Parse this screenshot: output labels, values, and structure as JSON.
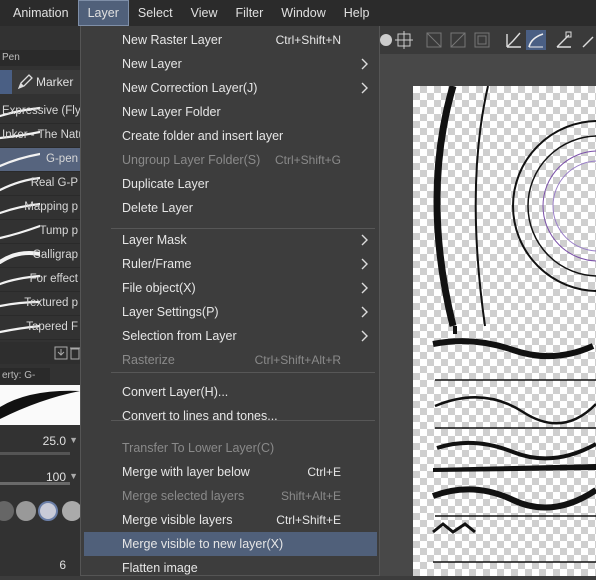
{
  "menubar": {
    "items": [
      "Animation",
      "Layer",
      "Select",
      "View",
      "Filter",
      "Window",
      "Help"
    ],
    "active": "Layer"
  },
  "left_panel": {
    "tab_label": "Pen",
    "marker_label": "Marker",
    "brushes": [
      {
        "label": "Expressive (Flyla"
      },
      {
        "label": "Inker - The Natu"
      },
      {
        "label": "G-pen"
      },
      {
        "label": "Real G-P"
      },
      {
        "label": "Mapping p"
      },
      {
        "label": "Tump p"
      },
      {
        "label": "Calligrap"
      },
      {
        "label": "For effect"
      },
      {
        "label": "Textured p"
      },
      {
        "label": "Tapered F"
      }
    ],
    "property_header": "erty: G-pen",
    "size_value": "25.0",
    "opacity_value": "100",
    "bottom_value": "6"
  },
  "layer_menu": {
    "items": [
      {
        "label": "New Raster Layer",
        "shortcut": "Ctrl+Shift+N",
        "submenu": false,
        "disabled": false
      },
      {
        "label": "New Layer",
        "shortcut": "",
        "submenu": true,
        "disabled": false
      },
      {
        "label": "New Correction Layer(J)",
        "shortcut": "",
        "submenu": true,
        "disabled": false
      },
      {
        "label": "New Layer Folder",
        "shortcut": "",
        "submenu": false,
        "disabled": false
      },
      {
        "label": "Create folder and insert layer",
        "shortcut": "",
        "submenu": false,
        "disabled": false
      },
      {
        "label": "Ungroup Layer Folder(S)",
        "shortcut": "Ctrl+Shift+G",
        "submenu": false,
        "disabled": true
      },
      {
        "label": "Duplicate Layer",
        "shortcut": "",
        "submenu": false,
        "disabled": false
      },
      {
        "label": "Delete Layer",
        "shortcut": "",
        "submenu": false,
        "disabled": false
      },
      {
        "label": "Layer Mask",
        "shortcut": "",
        "submenu": true,
        "disabled": false
      },
      {
        "label": "Ruler/Frame",
        "shortcut": "",
        "submenu": true,
        "disabled": false
      },
      {
        "label": "File object(X)",
        "shortcut": "",
        "submenu": true,
        "disabled": false
      },
      {
        "label": "Layer Settings(P)",
        "shortcut": "",
        "submenu": true,
        "disabled": false
      },
      {
        "label": "Selection from Layer",
        "shortcut": "",
        "submenu": true,
        "disabled": false
      },
      {
        "label": "Rasterize",
        "shortcut": "Ctrl+Shift+Alt+R",
        "submenu": false,
        "disabled": true
      },
      {
        "label": "Convert Layer(H)...",
        "shortcut": "",
        "submenu": false,
        "disabled": false
      },
      {
        "label": "Convert to lines and tones...",
        "shortcut": "",
        "submenu": false,
        "disabled": false
      },
      {
        "label": "Transfer To Lower Layer(C)",
        "shortcut": "",
        "submenu": false,
        "disabled": true
      },
      {
        "label": "Merge with layer below",
        "shortcut": "Ctrl+E",
        "submenu": false,
        "disabled": false
      },
      {
        "label": "Merge selected layers",
        "shortcut": "Shift+Alt+E",
        "submenu": false,
        "disabled": true
      },
      {
        "label": "Merge visible layers",
        "shortcut": "Ctrl+Shift+E",
        "submenu": false,
        "disabled": false
      },
      {
        "label": "Merge visible to new layer(X)",
        "shortcut": "",
        "submenu": false,
        "disabled": false,
        "highlighted": true
      },
      {
        "label": "Flatten image",
        "shortcut": "",
        "submenu": false,
        "disabled": false
      }
    ]
  },
  "colors": {
    "highlight": "#50607a",
    "menu_bg": "#3d3d3d",
    "menubar_bg": "#2b2b2b",
    "disabled_text": "#8a8a8a"
  }
}
